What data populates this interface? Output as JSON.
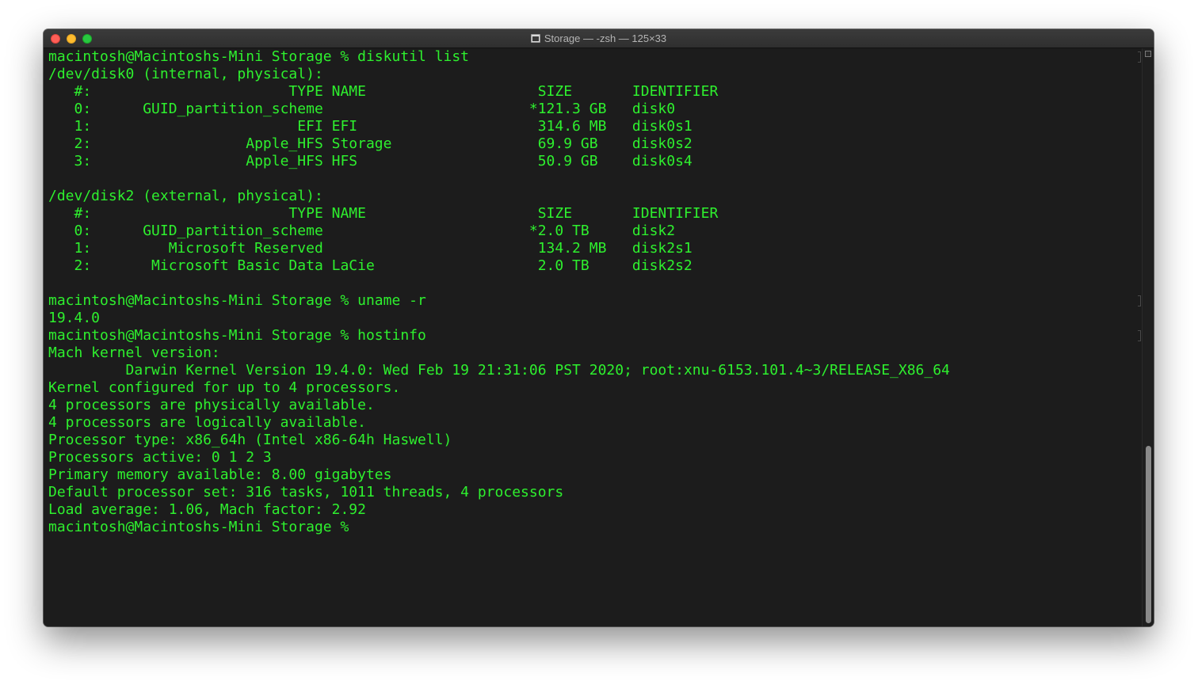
{
  "window": {
    "title": "Storage — -zsh — 125×33"
  },
  "terminal": {
    "lines": [
      "macintosh@Macintoshs-Mini Storage % diskutil list",
      "/dev/disk0 (internal, physical):",
      "   #:                       TYPE NAME                    SIZE       IDENTIFIER",
      "   0:      GUID_partition_scheme                        *121.3 GB   disk0",
      "   1:                        EFI EFI                     314.6 MB   disk0s1",
      "   2:                  Apple_HFS Storage                 69.9 GB    disk0s2",
      "   3:                  Apple_HFS HFS                     50.9 GB    disk0s4",
      "",
      "/dev/disk2 (external, physical):",
      "   #:                       TYPE NAME                    SIZE       IDENTIFIER",
      "   0:      GUID_partition_scheme                        *2.0 TB     disk2",
      "   1:         Microsoft Reserved                         134.2 MB   disk2s1",
      "   2:       Microsoft Basic Data LaCie                   2.0 TB     disk2s2",
      "",
      "macintosh@Macintoshs-Mini Storage % uname -r",
      "19.4.0",
      "macintosh@Macintoshs-Mini Storage % hostinfo",
      "Mach kernel version:",
      "\t Darwin Kernel Version 19.4.0: Wed Feb 19 21:31:06 PST 2020; root:xnu-6153.101.4~3/RELEASE_X86_64",
      "Kernel configured for up to 4 processors.",
      "4 processors are physically available.",
      "4 processors are logically available.",
      "Processor type: x86_64h (Intel x86-64h Haswell)",
      "Processors active: 0 1 2 3",
      "Primary memory available: 8.00 gigabytes",
      "Default processor set: 316 tasks, 1011 threads, 4 processors",
      "Load average: 1.06, Mach factor: 2.92",
      "macintosh@Macintoshs-Mini Storage % "
    ]
  },
  "colors": {
    "terminal_text": "#2ef02e",
    "terminal_background": "#1c1c1c"
  }
}
